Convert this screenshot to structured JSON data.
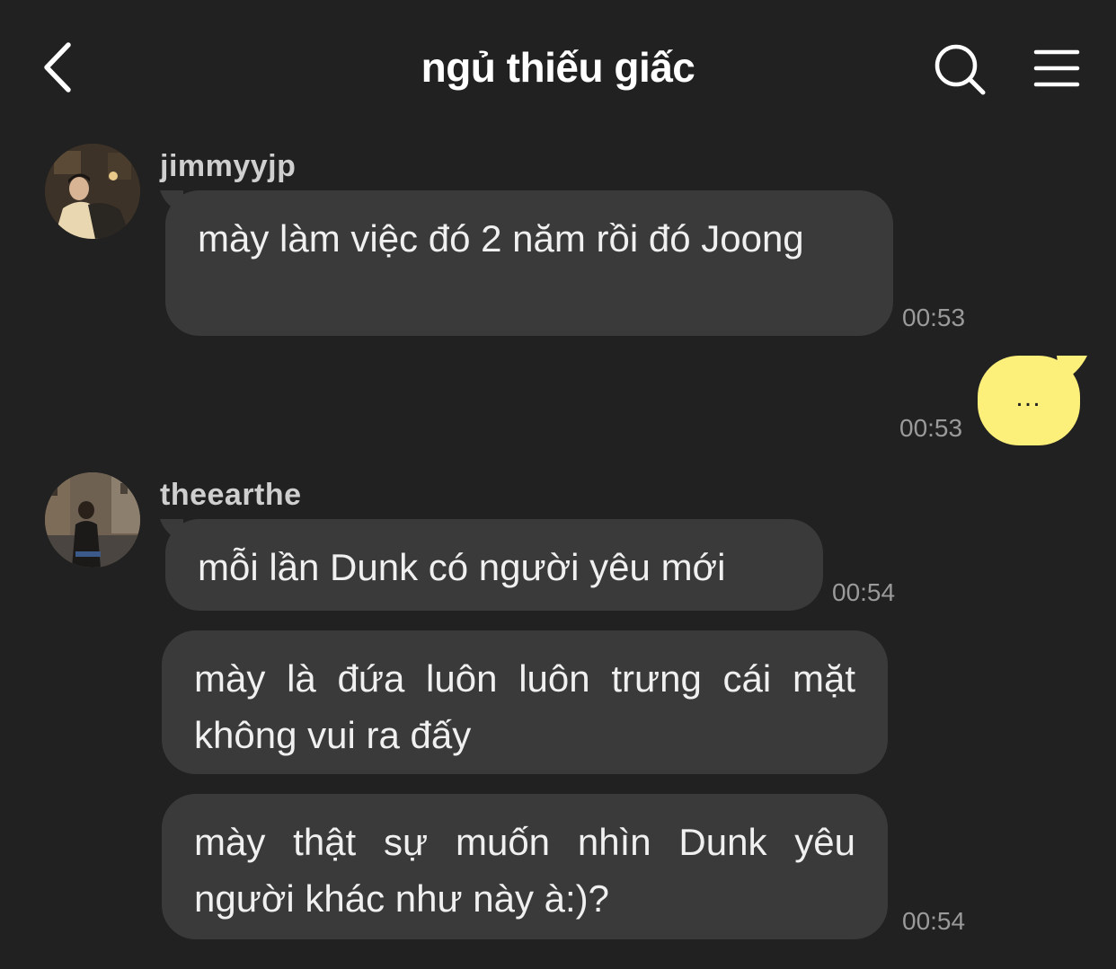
{
  "header": {
    "title": "ngủ thiếu giấc",
    "back_icon": "chevron-left-icon",
    "search_icon": "search-icon",
    "menu_icon": "hamburger-menu-icon"
  },
  "colors": {
    "background": "#212121",
    "incoming_bubble": "#3a3a3a",
    "outgoing_bubble": "#fdf07a",
    "timestamp": "#9a9a9a"
  },
  "messages": [
    {
      "sender": "jimmyyjp",
      "direction": "incoming",
      "text": "mày làm việc đó 2 năm rồi đó Joong",
      "time": "00:53"
    },
    {
      "sender": "",
      "direction": "outgoing",
      "text": "…",
      "time": "00:53"
    },
    {
      "sender": "theearthe",
      "direction": "incoming",
      "text": "mỗi lần Dunk có người yêu mới",
      "time": "00:54"
    },
    {
      "sender": "theearthe",
      "direction": "incoming",
      "text": "mày là đứa luôn luôn trưng cái mặt không vui ra đấy",
      "time": ""
    },
    {
      "sender": "theearthe",
      "direction": "incoming",
      "text": "mày thật sự muốn nhìn Dunk yêu người khác như này à:)?",
      "time": "00:54"
    }
  ]
}
